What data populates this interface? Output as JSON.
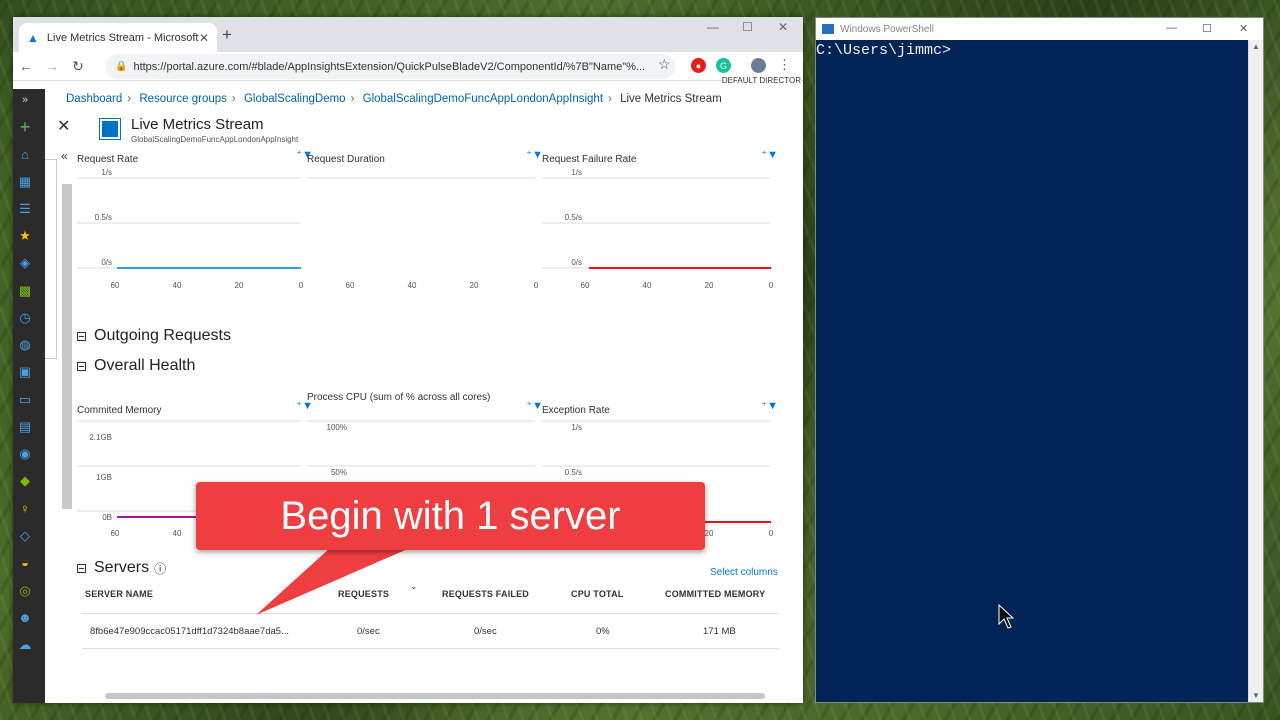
{
  "browser": {
    "tab_title": "Live Metrics Stream - Microsoft A",
    "url": "https://portal.azure.com/#blade/AppInsightsExtension/QuickPulseBladeV2/ComponentId/%7B\"Name\"%...",
    "directory_label": "DEFAULT DIRECTOR"
  },
  "breadcrumb": [
    "Dashboard",
    "Resource groups",
    "GlobalScalingDemo",
    "GlobalScalingDemoFuncAppLondonAppInsight",
    "Live Metrics Stream"
  ],
  "blade": {
    "title": "Live Metrics Stream",
    "subtitle": "GlobalScalingDemoFuncAppLondonAppInsight"
  },
  "charts": {
    "request_rate": {
      "title": "Request Rate",
      "ticks_y": [
        "1/s",
        "0.5/s",
        "0/s"
      ],
      "ticks_x": [
        "60",
        "40",
        "20",
        "0"
      ],
      "color": "#2a9fd8",
      "value": 0
    },
    "request_duration": {
      "title": "Request Duration",
      "ticks_x": [
        "60",
        "40",
        "20",
        "0"
      ]
    },
    "request_failure_rate": {
      "title": "Request Failure Rate",
      "ticks_y": [
        "1/s",
        "0.5/s",
        "0/s"
      ],
      "ticks_x": [
        "60",
        "40",
        "20",
        "0"
      ],
      "color": "#e81123",
      "value": 0
    },
    "committed_memory": {
      "title": "Commited Memory",
      "ticks_y": [
        "2.1GB",
        "1GB",
        "0B"
      ],
      "ticks_x": [
        "60",
        "40"
      ],
      "color": "#a0189c"
    },
    "process_cpu": {
      "title": "Process CPU (sum of % across all cores)",
      "ticks_y": [
        "100%",
        "50%"
      ]
    },
    "exception_rate": {
      "title": "Exception Rate",
      "ticks_y": [
        "1/s",
        "0.5/s"
      ],
      "ticks_x": [
        "20",
        "0"
      ],
      "color": "#e81123"
    }
  },
  "sections": {
    "outgoing": "Outgoing Requests",
    "health": "Overall Health",
    "servers": "Servers"
  },
  "servers": {
    "select_columns": "Select columns",
    "headers": [
      "SERVER NAME",
      "REQUESTS",
      "REQUESTS FAILED",
      "CPU TOTAL",
      "COMMITTED MEMORY"
    ],
    "rows": [
      {
        "name": "8fb6e47e909ccac05171dff1d7324b8aae7da5...",
        "requests": "0/sec",
        "failed": "0/sec",
        "cpu": "0%",
        "memory": "171 MB"
      }
    ]
  },
  "callout": {
    "text": "Begin with 1 server",
    "color": "#ef3e42"
  },
  "powershell": {
    "title": "Windows PowerShell",
    "prompt": "C:\\Users\\jimmc>"
  }
}
